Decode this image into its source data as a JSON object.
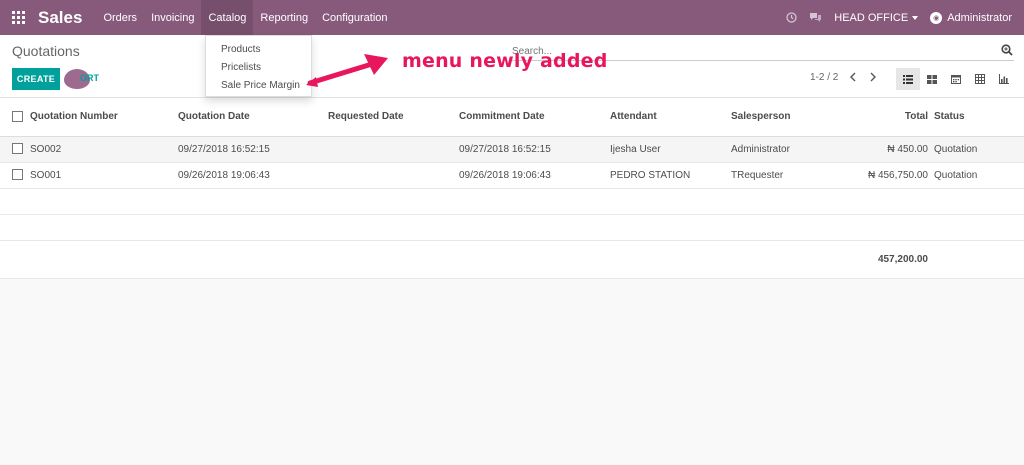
{
  "navbar": {
    "brand": "Sales",
    "menu": [
      "Orders",
      "Invoicing",
      "Catalog",
      "Reporting",
      "Configuration"
    ],
    "company": "HEAD OFFICE",
    "user": "Administrator",
    "bg_color": "#875a7b"
  },
  "catalog_menu": {
    "items": [
      "Products",
      "Pricelists",
      "Sale Price Margin"
    ]
  },
  "control_panel": {
    "breadcrumb": "Quotations",
    "create_label": "CREATE",
    "import_label": "ORT",
    "search_placeholder": "Search...",
    "pager": "1-2 / 2"
  },
  "annotation": {
    "text": "menu newly added",
    "color": "#e8175d"
  },
  "table": {
    "columns": [
      "Quotation Number",
      "Quotation Date",
      "Requested Date",
      "Commitment Date",
      "Attendant",
      "Salesperson",
      "Total",
      "Status"
    ],
    "rows": [
      {
        "number": "SO002",
        "quotation_date": "09/27/2018 16:52:15",
        "requested_date": "",
        "commitment_date": "09/27/2018 16:52:15",
        "attendant": "Ijesha User",
        "salesperson": "Administrator",
        "total": "₦ 450.00",
        "status": "Quotation"
      },
      {
        "number": "SO001",
        "quotation_date": "09/26/2018 19:06:43",
        "requested_date": "",
        "commitment_date": "09/26/2018 19:06:43",
        "attendant": "PEDRO STATION",
        "salesperson": "TRequester",
        "total": "₦ 456,750.00",
        "status": "Quotation"
      }
    ],
    "grand_total": "457,200.00"
  },
  "colors": {
    "primary": "#00a09d",
    "brand": "#875a7b"
  }
}
